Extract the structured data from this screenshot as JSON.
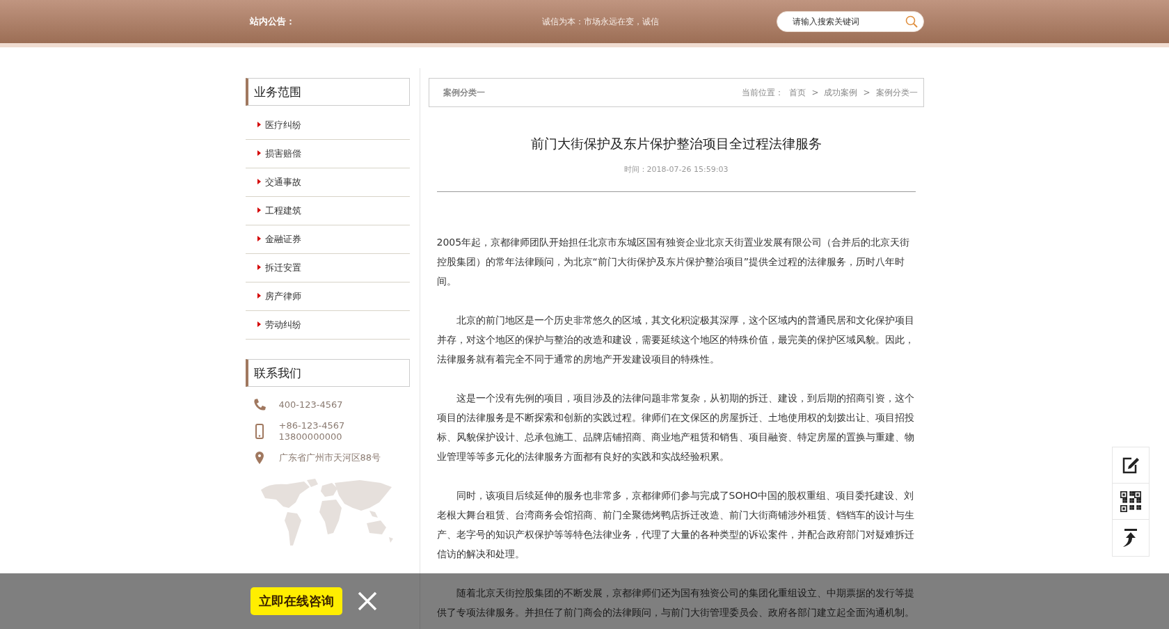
{
  "top_bar": {
    "notice_label": "站内公告：",
    "notice_text": "诚信为本：市场永远在变，诚信",
    "search": {
      "placeholder": "请输入搜索关键词"
    }
  },
  "sidebar": {
    "business": {
      "title": "业务范围",
      "items": [
        "医疗纠纷",
        "损害赔偿",
        "交通事故",
        "工程建筑",
        "金融证券",
        "拆迁安置",
        "房产律师",
        "劳动纠纷"
      ]
    },
    "contact": {
      "title": "联系我们",
      "items": [
        {
          "kind": "phone",
          "lines": [
            "400-123-4567"
          ]
        },
        {
          "kind": "mobile",
          "lines": [
            "+86-123-4567",
            "13800000000"
          ]
        },
        {
          "kind": "address",
          "lines": [
            "广东省广州市天河区88号"
          ]
        }
      ]
    }
  },
  "breadcrumb": {
    "category": "案例分类一",
    "location_label": "当前位置：",
    "separator": ">",
    "path": [
      "首页",
      "成功案例",
      "案例分类一"
    ]
  },
  "article": {
    "title": "前门大街保护及东片保护整治项目全过程法律服务",
    "time": "时间：2018-07-26 15:59:03",
    "paragraphs": [
      {
        "indent": false,
        "text": "2005年起，京都律师团队开始担任北京市东城区国有独资企业北京天街置业发展有限公司（合并后的北京天街控股集团）的常年法律顾问，为北京“前门大街保护及东片保护整治项目”提供全过程的法律服务，历时八年时间。"
      },
      {
        "indent": true,
        "text": "北京的前门地区是一个历史非常悠久的区域，其文化积淀极其深厚，这个区域内的普通民居和文化保护项目并存，对这个地区的保护与整治的改造和建设，需要延续这个地区的特殊价值，最完美的保护区域风貌。因此，法律服务就有着完全不同于通常的房地产开发建设项目的特殊性。"
      },
      {
        "indent": true,
        "text": "这是一个没有先例的项目，项目涉及的法律问题非常复杂，从初期的拆迁、建设，到后期的招商引资，这个项目的法律服务是不断探索和创新的实践过程。律师们在文保区的房屋拆迁、土地使用权的划拨出让、项目招投标、风貌保护设计、总承包施工、品牌店铺招商、商业地产租赁和销售、项目融资、特定房屋的置换与重建、物业管理等等多元化的法律服务方面都有良好的实践和实战经验积累。"
      },
      {
        "indent": true,
        "text": "同时，该项目后续延伸的服务也非常多，京都律师们参与完成了SOHO中国的股权重组、项目委托建设、刘老根大舞台租赁、台湾商务会馆招商、前门全聚德烤鸭店拆迁改造、前门大街商铺涉外租赁、铛铛车的设计与生产、老字号的知识产权保护等等特色法律业务，代理了大量的各种类型的诉讼案件，并配合政府部门对疑难拆迁信访的解决和处理。"
      },
      {
        "indent": true,
        "text": "随着北京天街控股集团的不断发展，京都律师们还为国有独资公司的集团化重组设立、中期票据的发行等提供了专项法律服务。并担任了前门商会的法律顾问，与前门大街管理委员会、政府各部门建立起全面沟通机制。"
      }
    ]
  },
  "float_tools": [
    {
      "kind": "edit"
    },
    {
      "kind": "qr"
    },
    {
      "kind": "top"
    }
  ],
  "consult_bar": {
    "button": "立即在线咨询"
  }
}
